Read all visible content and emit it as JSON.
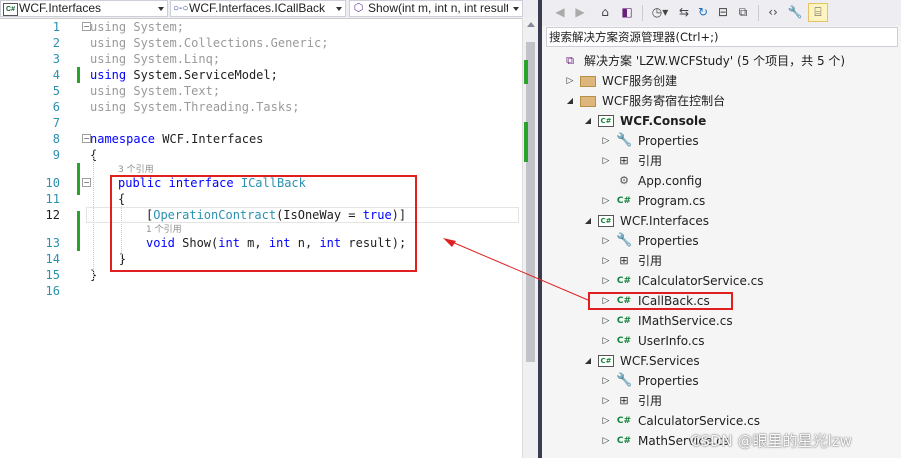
{
  "navbar": {
    "project_dropdown": "WCF.Interfaces",
    "type_dropdown": "WCF.Interfaces.ICallBack",
    "member_dropdown": "Show(int m, int n, int result)"
  },
  "editor": {
    "line_numbers": [
      "1",
      "2",
      "3",
      "4",
      "5",
      "6",
      "7",
      "8",
      "9",
      "10",
      "11",
      "12",
      "13",
      "14",
      "15",
      "16"
    ],
    "lines": [
      {
        "kw": "using",
        "rest": " System;",
        "dim": true
      },
      {
        "kw": "using",
        "rest": " System.Collections.Generic;",
        "dim": true
      },
      {
        "kw": "using",
        "rest": " System.Linq;",
        "dim": true
      },
      {
        "kw": "using",
        "rest": " System.ServiceModel;",
        "dim": false
      },
      {
        "kw": "using",
        "rest": " System.Text;",
        "dim": true
      },
      {
        "kw": "using",
        "rest": " System.Threading.Tasks;",
        "dim": true
      },
      {
        "kw": "",
        "rest": "",
        "dim": false
      },
      {
        "kw": "namespace",
        "rest": " WCF.Interfaces",
        "dim": false
      },
      {
        "kw": "",
        "rest": "{",
        "dim": false
      },
      {
        "kw": "",
        "rest": "",
        "dim": false
      },
      {
        "kw": "",
        "rest": "",
        "dim": false
      },
      {
        "kw": "",
        "rest": "",
        "dim": false
      },
      {
        "kw": "",
        "rest": "",
        "dim": false
      },
      {
        "kw": "",
        "rest": "    }",
        "dim": false
      },
      {
        "kw": "",
        "rest": "}",
        "dim": false
      },
      {
        "kw": "",
        "rest": "",
        "dim": false
      }
    ],
    "codelens_interface": "3 个引用",
    "codelens_method": "1 个引用",
    "line10": {
      "kw1": "public",
      "kw2": "interface",
      "type": "ICallBack"
    },
    "line11": "{",
    "line12": {
      "open": "[",
      "attr": "OperationContract",
      "args_pre": "(IsOneWay = ",
      "val": "true",
      "close": ")]"
    },
    "line13": {
      "kw_void": "void",
      "name": " Show(",
      "t1": "int",
      "p1": " m, ",
      "t2": "int",
      "p2": " n, ",
      "t3": "int",
      "p3": " result);"
    }
  },
  "solution_explorer": {
    "search_placeholder": "搜索解决方案资源管理器(Ctrl+;)",
    "nodes": [
      {
        "label": "解决方案 'LZW.WCFStudy' (5 个项目，共 5 个)",
        "icon": "solution-icon",
        "level": 0,
        "expander": "none",
        "bold": false
      },
      {
        "label": "WCF服务创建",
        "icon": "folder-icon",
        "level": 1,
        "expander": "closed",
        "bold": false
      },
      {
        "label": "WCF服务寄宿在控制台",
        "icon": "folder-icon",
        "level": 1,
        "expander": "open",
        "bold": false
      },
      {
        "label": "WCF.Console",
        "icon": "csharp-project-icon",
        "level": 2,
        "expander": "open",
        "bold": true
      },
      {
        "label": "Properties",
        "icon": "wrench-icon",
        "level": 3,
        "expander": "closed",
        "bold": false
      },
      {
        "label": "引用",
        "icon": "references-icon",
        "level": 3,
        "expander": "closed",
        "bold": false
      },
      {
        "label": "App.config",
        "icon": "config-file-icon",
        "level": 3,
        "expander": "none",
        "bold": false
      },
      {
        "label": "Program.cs",
        "icon": "csharp-file-icon",
        "level": 3,
        "expander": "closed",
        "bold": false
      },
      {
        "label": "WCF.Interfaces",
        "icon": "csharp-project-icon",
        "level": 2,
        "expander": "open",
        "bold": false
      },
      {
        "label": "Properties",
        "icon": "wrench-icon",
        "level": 3,
        "expander": "closed",
        "bold": false
      },
      {
        "label": "引用",
        "icon": "references-icon",
        "level": 3,
        "expander": "closed",
        "bold": false
      },
      {
        "label": "ICalculatorService.cs",
        "icon": "csharp-file-icon",
        "level": 3,
        "expander": "closed",
        "bold": false
      },
      {
        "label": "ICallBack.cs",
        "icon": "csharp-file-icon",
        "level": 3,
        "expander": "closed",
        "bold": false
      },
      {
        "label": "IMathService.cs",
        "icon": "csharp-file-icon",
        "level": 3,
        "expander": "closed",
        "bold": false
      },
      {
        "label": "UserInfo.cs",
        "icon": "csharp-file-icon",
        "level": 3,
        "expander": "closed",
        "bold": false
      },
      {
        "label": "WCF.Services",
        "icon": "csharp-project-icon",
        "level": 2,
        "expander": "open",
        "bold": false
      },
      {
        "label": "Properties",
        "icon": "wrench-icon",
        "level": 3,
        "expander": "closed",
        "bold": false
      },
      {
        "label": "引用",
        "icon": "references-icon",
        "level": 3,
        "expander": "closed",
        "bold": false
      },
      {
        "label": "CalculatorService.cs",
        "icon": "csharp-file-icon",
        "level": 3,
        "expander": "closed",
        "bold": false
      },
      {
        "label": "MathService.cs",
        "icon": "csharp-file-icon",
        "level": 3,
        "expander": "closed",
        "bold": false
      }
    ]
  },
  "watermark": "CSDN @眼里的星光lzw",
  "colors": {
    "keyword": "#0000ff",
    "type": "#2b91af",
    "highlight_box": "#e02020",
    "change_marker": "#2aa32a",
    "line_number": "#2b91af"
  }
}
